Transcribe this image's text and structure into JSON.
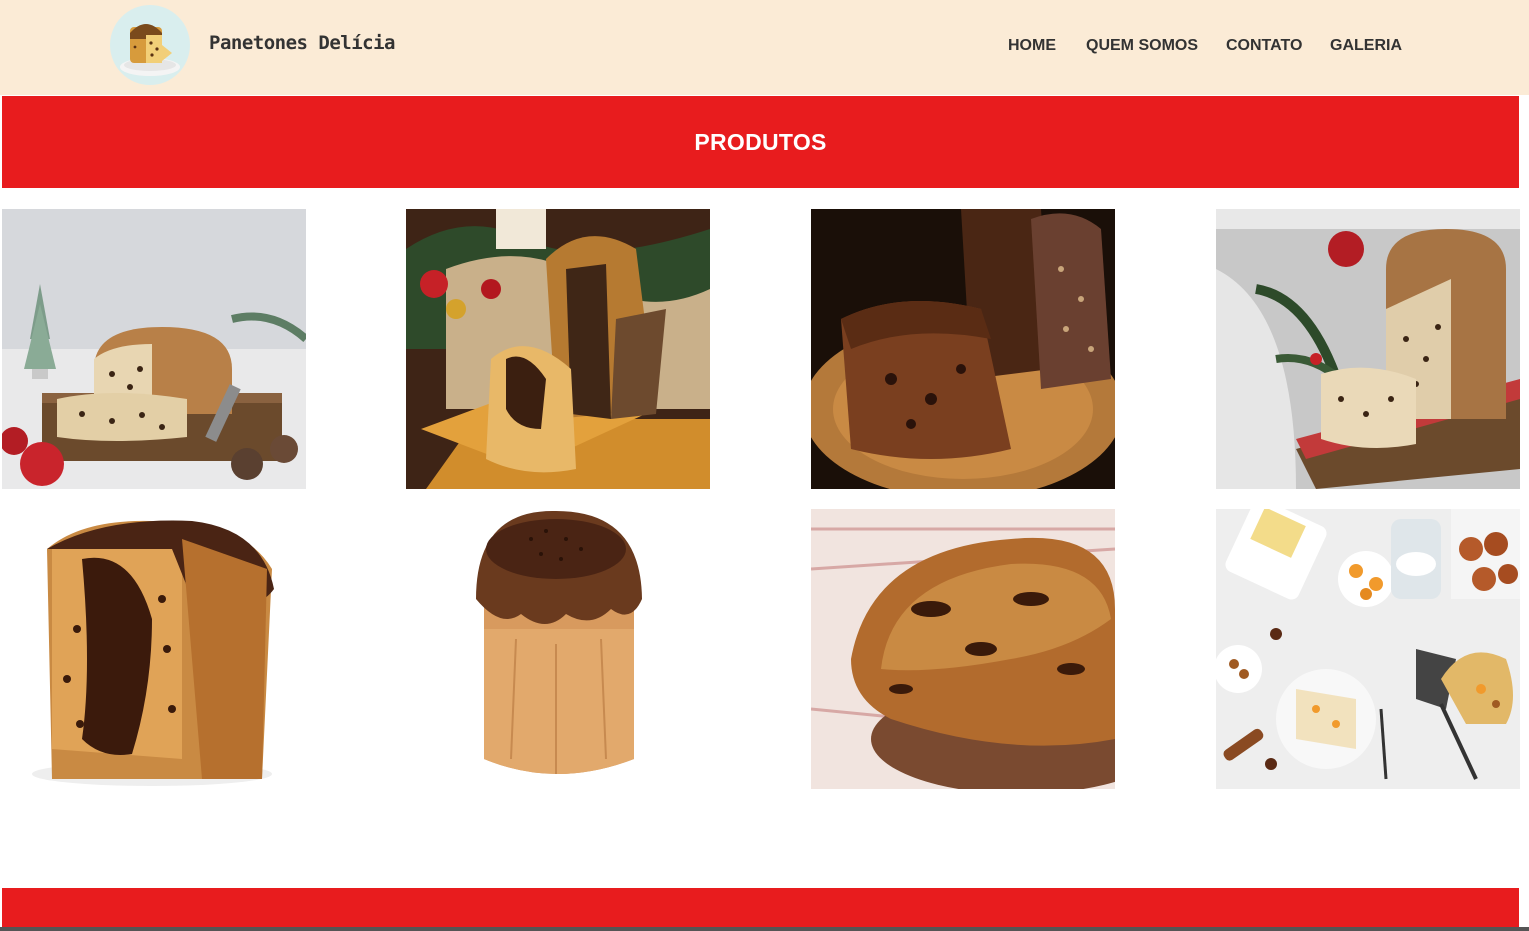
{
  "header": {
    "brand_name": "Panetones Delícia",
    "logo_icon": "panettone-logo-icon",
    "nav": [
      {
        "label": "HOME"
      },
      {
        "label": "QUEM SOMOS"
      },
      {
        "label": "CONTATO"
      },
      {
        "label": "GALERIA"
      }
    ]
  },
  "section": {
    "title": "PRODUTOS"
  },
  "products": [
    {
      "image": "panettone-sliced-christmas-tree"
    },
    {
      "image": "panettone-chocolate-filled-board"
    },
    {
      "image": "chocotone-slice-dark"
    },
    {
      "image": "panettone-snowy-table"
    },
    {
      "image": "panettone-chocolate-topping-cut"
    },
    {
      "image": "chocotone-sprinkles"
    },
    {
      "image": "panettone-closeup-crust"
    },
    {
      "image": "panettone-ingredients-flatlay"
    }
  ],
  "colors": {
    "header_bg": "#fbebd6",
    "accent_red": "#e81c1e",
    "nav_text": "#333333"
  }
}
